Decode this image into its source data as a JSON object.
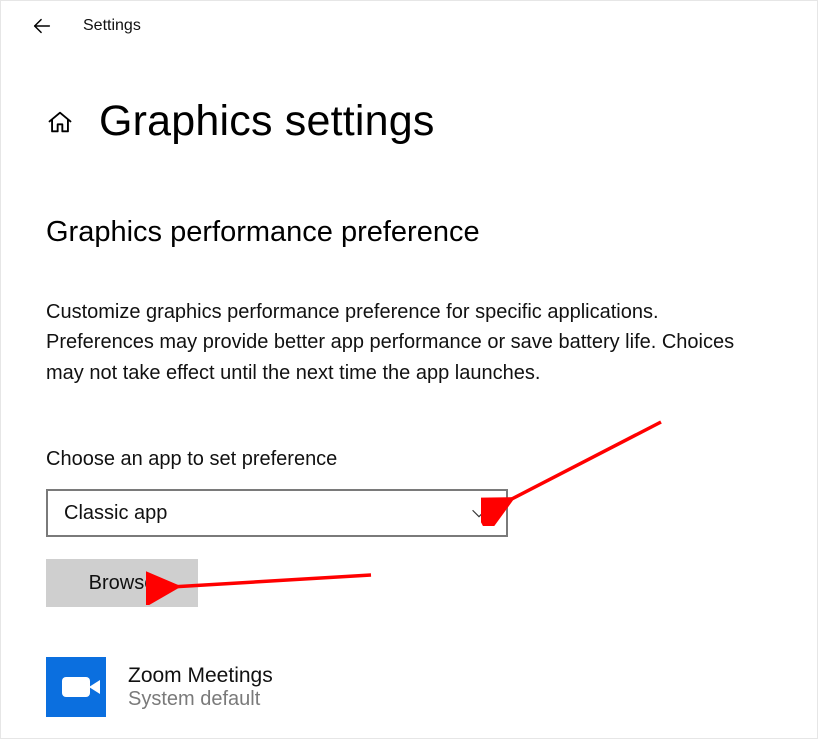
{
  "topbar": {
    "title": "Settings"
  },
  "page": {
    "title": "Graphics settings"
  },
  "section": {
    "heading": "Graphics performance preference",
    "description": "Customize graphics performance preference for specific applications. Preferences may provide better app performance or save battery life. Choices may not take effect until the next time the app launches."
  },
  "choose": {
    "label": "Choose an app to set preference"
  },
  "dropdown": {
    "selected": "Classic app"
  },
  "buttons": {
    "browse": "Browse"
  },
  "apps": [
    {
      "name": "Zoom Meetings",
      "subtitle": "System default",
      "icon": "camera-icon"
    }
  ]
}
